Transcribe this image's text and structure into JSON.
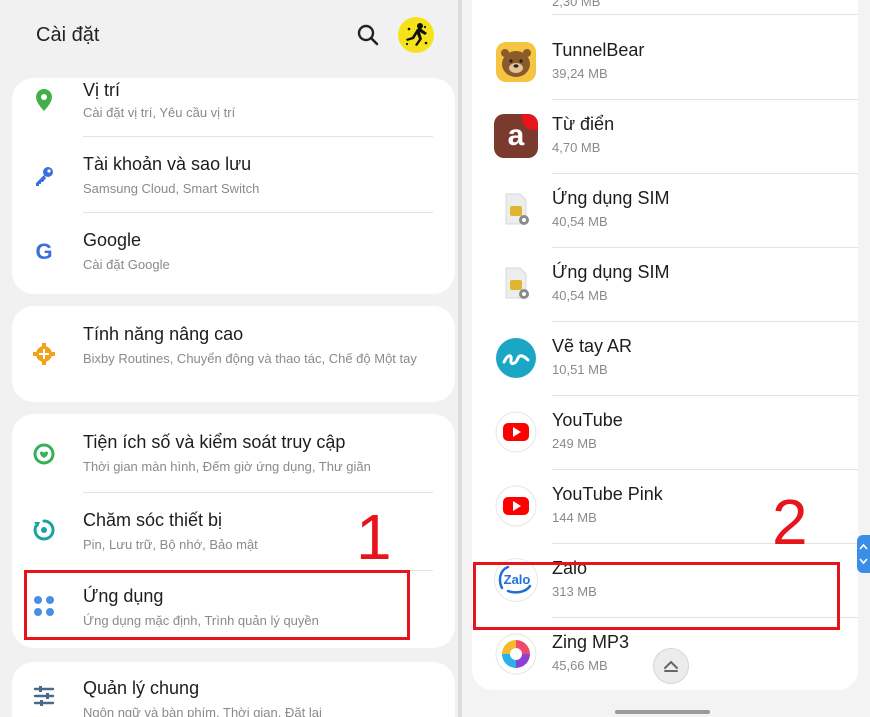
{
  "header": {
    "title": "Cài đặt"
  },
  "settings": {
    "location": {
      "title": "Vị trí",
      "subtitle": "Cài đặt vị trí, Yêu cầu vị trí"
    },
    "accounts": {
      "title": "Tài khoản và sao lưu",
      "subtitle": "Samsung Cloud, Smart Switch"
    },
    "google": {
      "title": "Google",
      "subtitle": "Cài đặt Google"
    },
    "advanced": {
      "title": "Tính năng nâng cao",
      "subtitle": "Bixby Routines, Chuyển động và thao tác, Chế độ Một tay"
    },
    "wellbeing": {
      "title": "Tiện ích số và kiểm soát truy cập",
      "subtitle": "Thời gian màn hình, Đếm giờ ứng dụng, Thư giãn"
    },
    "care": {
      "title": "Chăm sóc thiết bị",
      "subtitle": "Pin, Lưu trữ, Bộ nhớ, Bảo mật"
    },
    "apps": {
      "title": "Ứng dụng",
      "subtitle": "Ứng dụng mặc định, Trình quản lý quyền"
    },
    "general": {
      "title": "Quản lý chung",
      "subtitle": "Ngôn ngữ và bàn phím, Thời gian, Đặt lại"
    }
  },
  "apps_list": {
    "partial_size": "2,30 MB",
    "items": [
      {
        "name": "TunnelBear",
        "size": "39,24 MB"
      },
      {
        "name": "Từ điển",
        "size": "4,70 MB"
      },
      {
        "name": "Ứng dụng SIM",
        "size": "40,54 MB"
      },
      {
        "name": "Ứng dụng SIM",
        "size": "40,54 MB"
      },
      {
        "name": "Vẽ tay AR",
        "size": "10,51 MB"
      },
      {
        "name": "YouTube",
        "size": "249 MB"
      },
      {
        "name": "YouTube Pink",
        "size": "144 MB"
      },
      {
        "name": "Zalo",
        "size": "313 MB"
      },
      {
        "name": "Zing MP3",
        "size": "45,66 MB"
      }
    ],
    "zalo_icon_text": "Zalo",
    "tudien_icon_text": "a"
  },
  "annotations": {
    "step1": "1",
    "step2": "2"
  },
  "colors": {
    "highlight": "#e8141c",
    "accent": "#3a8ee6"
  }
}
